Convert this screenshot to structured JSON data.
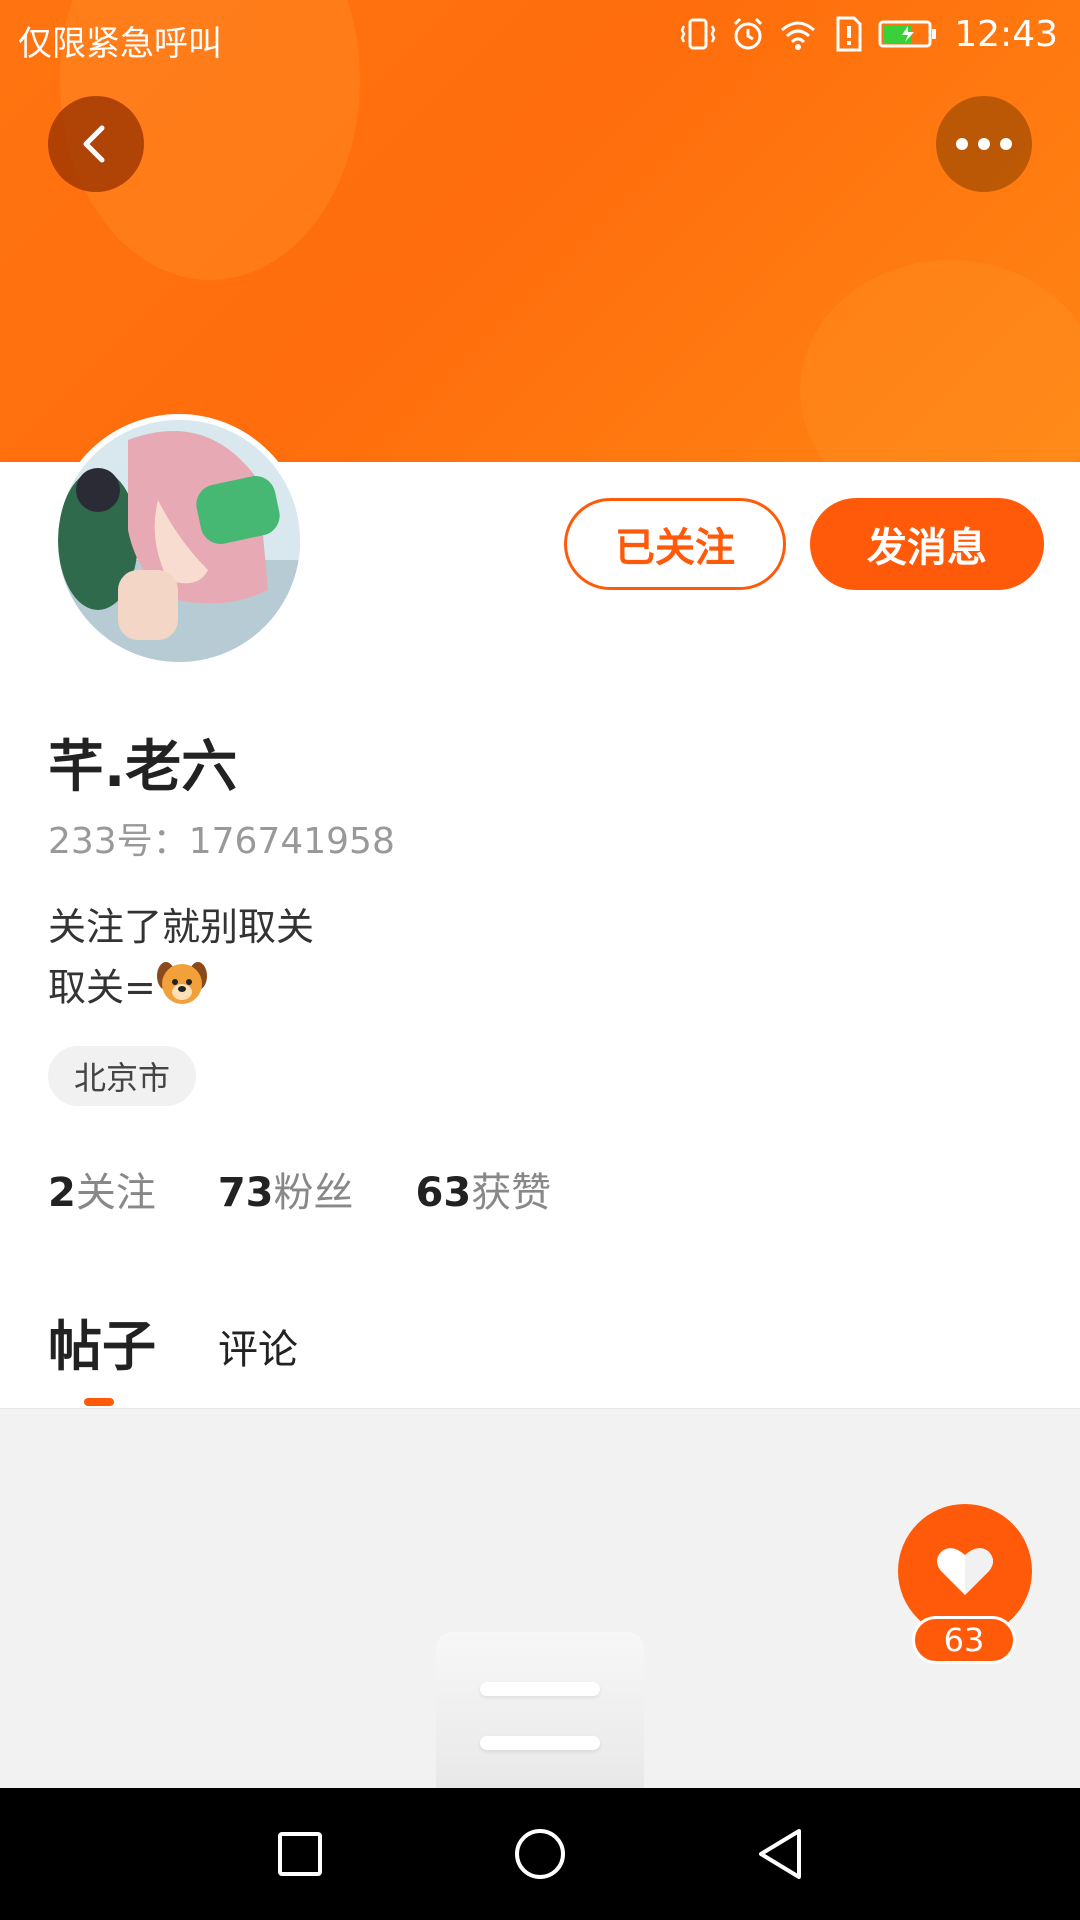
{
  "status_bar": {
    "carrier_text": "仅限紧急呼叫",
    "time": "12:43",
    "icons": [
      "vibrate-icon",
      "alarm-icon",
      "wifi-icon",
      "sim-alert-icon",
      "battery-charging-icon"
    ]
  },
  "header": {
    "back_icon": "chevron-left-icon",
    "more_icon": "more-dots-icon"
  },
  "profile": {
    "name": "芊.老六",
    "id_text": "233号：176741958",
    "bio_line1": "关注了就别取关",
    "bio_line2_prefix": "取关=",
    "bio_emoji": "dog-face-icon",
    "location": "北京市",
    "follow_button": "已关注",
    "message_button": "发消息"
  },
  "stats": [
    {
      "num": "2",
      "label": "关注"
    },
    {
      "num": "73",
      "label": "粉丝"
    },
    {
      "num": "63",
      "label": "获赞"
    }
  ],
  "tabs": {
    "active": "帖子",
    "other": "评论"
  },
  "like_fab": {
    "icon": "heart-icon",
    "count": "63"
  },
  "colors": {
    "accent": "#ff5a0a",
    "banner": "#ff7410"
  }
}
